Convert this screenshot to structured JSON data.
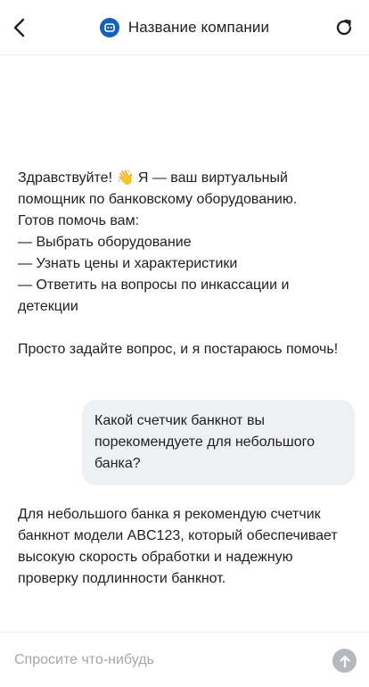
{
  "header": {
    "back_icon": "chevron-left-icon",
    "logo_icon": "chat-bot-icon",
    "title": "Название компании",
    "refresh_icon": "refresh-icon",
    "accent_color": "#1660b8"
  },
  "messages": [
    {
      "role": "assistant",
      "lines": [
        "Здравствуйте! 👋 Я — ваш виртуальный помощник по банковскому оборудованию.",
        "Готов помочь вам:",
        "— Выбрать оборудование",
        "— Узнать цены и характеристики",
        "— Ответить на вопросы по инкассации и детекции"
      ],
      "closing": "Просто задайте вопрос, и я постараюсь помочь!"
    },
    {
      "role": "user",
      "text": "Какой счетчик банкнот вы порекомендуете для небольшого банка?"
    },
    {
      "role": "assistant",
      "text": "Для небольшого банка я рекомендую счетчик банкнот модели ABC123, который обеспечивает высокую скорость обработки и надежную проверку подлинности банкнот."
    }
  ],
  "input": {
    "value": "",
    "placeholder": "Спросите что-нибудь",
    "send_icon": "arrow-up-icon"
  }
}
